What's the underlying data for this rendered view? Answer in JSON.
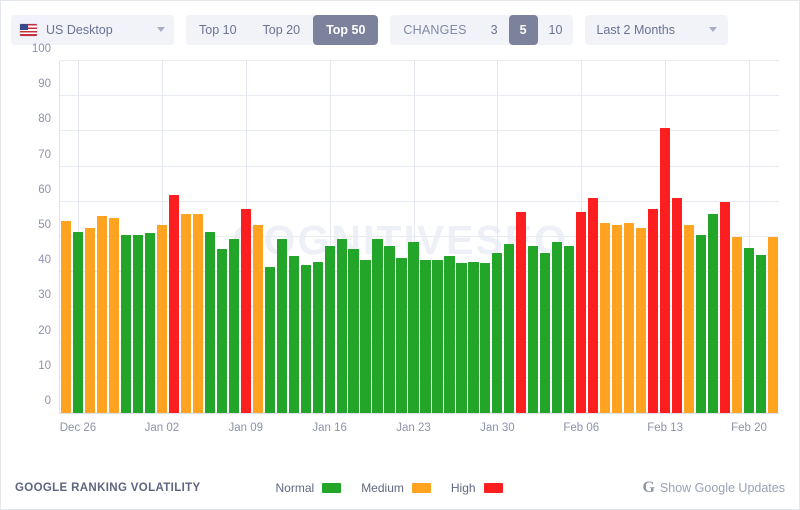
{
  "toolbar": {
    "market_select": {
      "label": "US Desktop",
      "icon": "us-flag-icon",
      "caret": "chevron-down-icon"
    },
    "top_group": {
      "options": [
        {
          "label": "Top 10",
          "active": false
        },
        {
          "label": "Top 20",
          "active": false
        },
        {
          "label": "Top 50",
          "active": true
        }
      ]
    },
    "changes_group": {
      "label": "CHANGES",
      "options": [
        {
          "label": "3",
          "active": false
        },
        {
          "label": "5",
          "active": true
        },
        {
          "label": "10",
          "active": false
        }
      ]
    },
    "range_select": {
      "label": "Last 2 Months",
      "caret": "chevron-down-icon"
    }
  },
  "footer": {
    "title": "GOOGLE RANKING VOLATILITY",
    "legend": [
      {
        "label": "Normal",
        "color": "#22a528"
      },
      {
        "label": "Medium",
        "color": "#ffa320"
      },
      {
        "label": "High",
        "color": "#fd1f1f"
      }
    ],
    "google_updates": {
      "logo": "G",
      "label": "Show Google Updates"
    }
  },
  "watermark": "COGNITIVESEO",
  "chart_data": {
    "type": "bar",
    "title": "GOOGLE RANKING VOLATILITY",
    "xlabel": "",
    "ylabel": "",
    "ylim": [
      0,
      100
    ],
    "yticks": [
      0,
      10,
      20,
      30,
      40,
      50,
      60,
      70,
      80,
      90,
      100
    ],
    "grid": true,
    "legend_position": "bottom",
    "xtick_labels": [
      "Dec 26",
      "Jan 02",
      "Jan 09",
      "Jan 16",
      "Jan 23",
      "Jan 30",
      "Feb 06",
      "Feb 13",
      "Feb 20"
    ],
    "xtick_indices": [
      1,
      8,
      15,
      22,
      29,
      36,
      43,
      50,
      57
    ],
    "categories": [
      "Dec 25",
      "Dec 26",
      "Dec 27",
      "Dec 28",
      "Dec 29",
      "Dec 30",
      "Dec 31",
      "Jan 01",
      "Jan 02",
      "Jan 03",
      "Jan 04",
      "Jan 05",
      "Jan 06",
      "Jan 07",
      "Jan 08",
      "Jan 09",
      "Jan 10",
      "Jan 11",
      "Jan 12",
      "Jan 13",
      "Jan 14",
      "Jan 15",
      "Jan 16",
      "Jan 17",
      "Jan 18",
      "Jan 19",
      "Jan 20",
      "Jan 21",
      "Jan 22",
      "Jan 23",
      "Jan 24",
      "Jan 25",
      "Jan 26",
      "Jan 27",
      "Jan 28",
      "Jan 29",
      "Jan 30",
      "Jan 31",
      "Feb 01",
      "Feb 02",
      "Feb 03",
      "Feb 04",
      "Feb 05",
      "Feb 06",
      "Feb 07",
      "Feb 08",
      "Feb 09",
      "Feb 10",
      "Feb 11",
      "Feb 12",
      "Feb 13",
      "Feb 14",
      "Feb 15",
      "Feb 16",
      "Feb 17",
      "Feb 18",
      "Feb 19",
      "Feb 20",
      "Feb 21",
      "Feb 22"
    ],
    "values": [
      54.5,
      51.5,
      52.5,
      56.0,
      55.5,
      50.5,
      50.5,
      51.0,
      53.5,
      62.0,
      56.5,
      56.5,
      51.5,
      46.5,
      49.5,
      58.0,
      53.5,
      41.5,
      49.5,
      44.5,
      42.0,
      43.0,
      47.5,
      49.5,
      46.5,
      43.5,
      49.5,
      47.5,
      44.0,
      48.5,
      43.5,
      43.5,
      44.5,
      42.5,
      43.0,
      42.5,
      45.5,
      48.0,
      57.0,
      47.5,
      45.5,
      48.5,
      47.5,
      57.0,
      61.0,
      54.0,
      53.5,
      54.0,
      52.5,
      58.0,
      81.0,
      61.0,
      53.5,
      50.5,
      56.5,
      60.0,
      50.0,
      47.0,
      45.0,
      50.0
    ],
    "bands": [
      "High",
      "Normal",
      "High",
      "High",
      "High",
      "Normal",
      "Normal",
      "Normal",
      "High",
      "Very High",
      "High",
      "High",
      "Normal",
      "Normal",
      "Normal",
      "Very High",
      "High",
      "Normal",
      "Normal",
      "Normal",
      "Normal",
      "Normal",
      "Normal",
      "Normal",
      "Normal",
      "Normal",
      "Normal",
      "Normal",
      "Normal",
      "Normal",
      "Normal",
      "Normal",
      "Normal",
      "Normal",
      "Normal",
      "Normal",
      "Normal",
      "Normal",
      "Very High",
      "Normal",
      "Normal",
      "Normal",
      "Normal",
      "Very High",
      "Very High",
      "High",
      "High",
      "High",
      "High",
      "Very High",
      "Very High",
      "Very High",
      "High",
      "Normal",
      "Normal",
      "Very High",
      "High",
      "Normal",
      "Normal",
      "High"
    ],
    "band_colors": {
      "Normal": "#22a528",
      "High": "#ffa320",
      "Very High": "#fd1f1f"
    }
  }
}
